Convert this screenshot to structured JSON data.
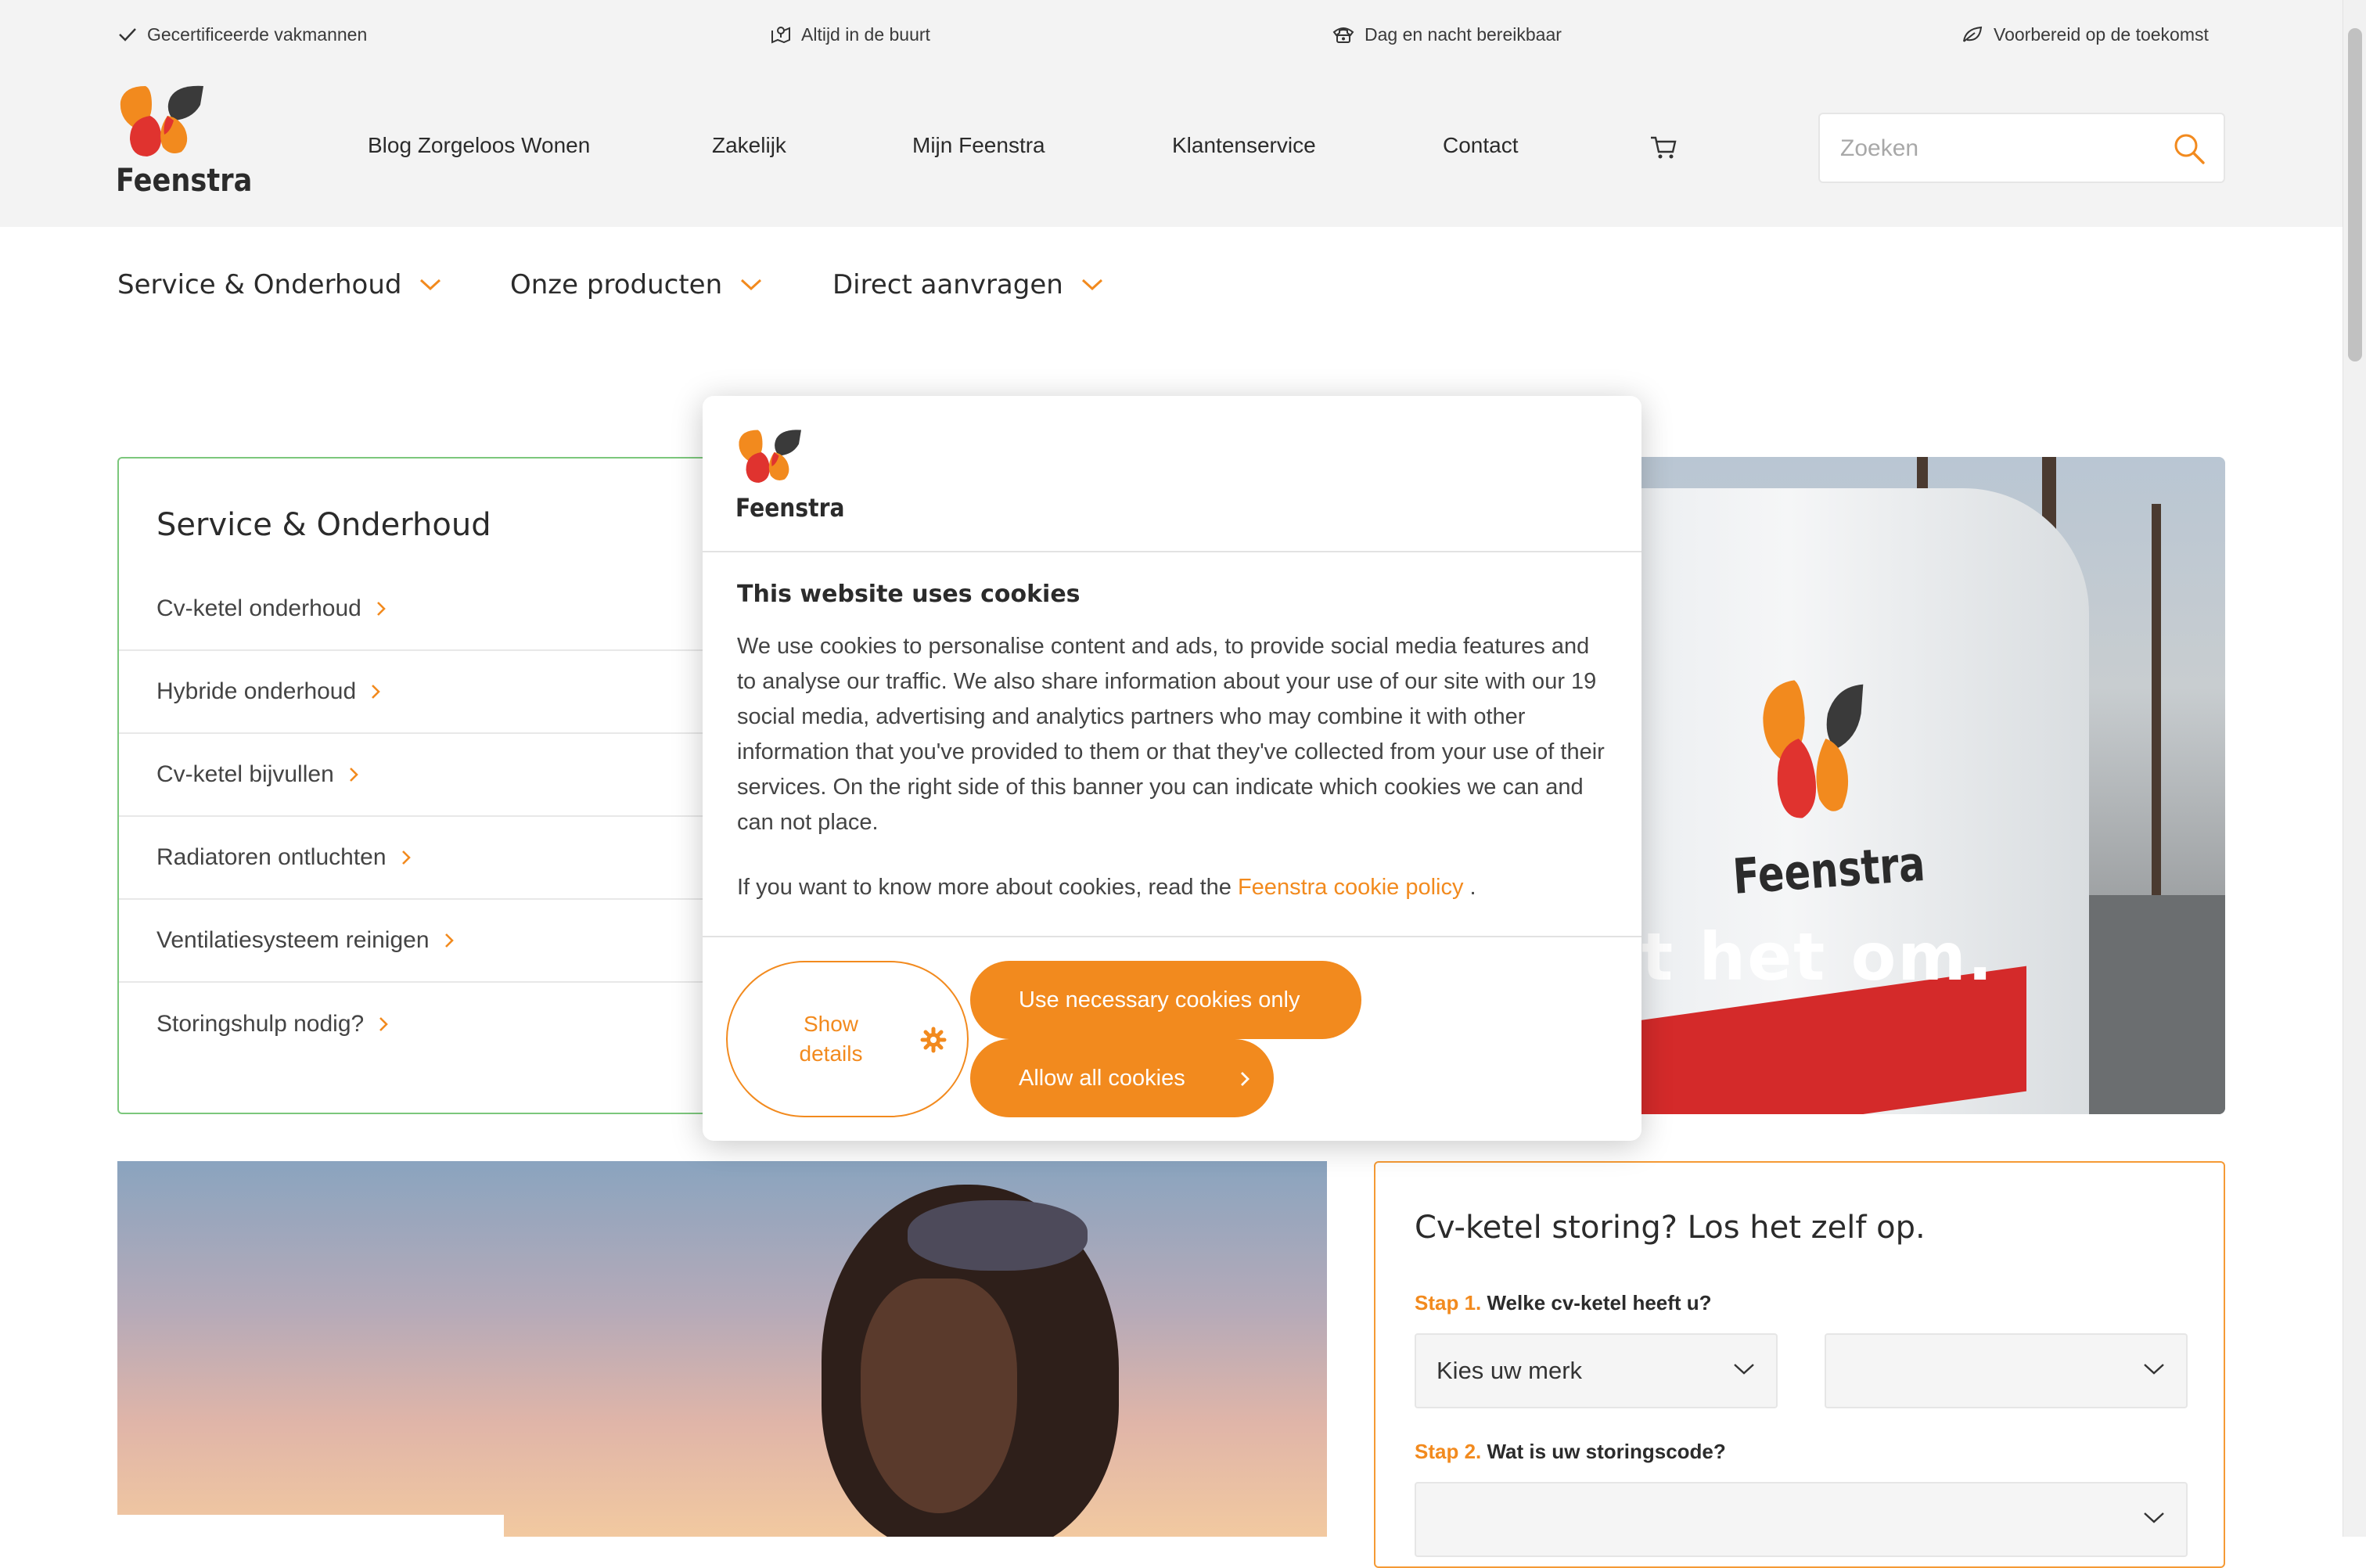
{
  "usp": [
    {
      "icon": "check-icon",
      "label": "Gecertificeerde vakmannen"
    },
    {
      "icon": "map-icon",
      "label": "Altijd in de buurt"
    },
    {
      "icon": "phone-icon",
      "label": "Dag en nacht bereikbaar"
    },
    {
      "icon": "leaf-icon",
      "label": "Voorbereid op de toekomst"
    }
  ],
  "brand": {
    "name": "Feenstra",
    "accent": "#f28a1e",
    "green": "#7cc77c"
  },
  "main_nav": [
    "Blog Zorgeloos Wonen",
    "Zakelijk",
    "Mijn Feenstra",
    "Klantenservice",
    "Contact"
  ],
  "search": {
    "placeholder": "Zoeken"
  },
  "sub_nav": [
    "Service & Onderhoud",
    "Onze producten",
    "Direct aanvragen"
  ],
  "service_panel": {
    "title": "Service & Onderhoud",
    "items": [
      "Cv-ketel onderhoud",
      "Hybride onderhoud",
      "Cv-ketel bijvullen",
      "Radiatoren ontluchten",
      "Ventilatiesysteem reinigen",
      "Storingshulp nodig?"
    ]
  },
  "hero": {
    "text_visible": "t het om.",
    "van_brand": "Feenstra"
  },
  "storing_panel": {
    "title": "Cv-ketel storing? Los het zelf op.",
    "step1": {
      "num": "Stap 1.",
      "label": "Welke cv-ketel heeft u?"
    },
    "brand_select": "Kies uw merk",
    "step2": {
      "num": "Stap 2.",
      "label": "Wat is uw storingscode?"
    }
  },
  "cookie": {
    "title": "This website uses cookies",
    "body": "We use cookies to personalise content and ads, to provide social media features and to analyse our traffic. We also share information about your use of our site with our 19 social media, advertising and analytics partners who may combine it with other information that you've provided to them or that they've collected from your use of their services. On the right side of this banner you can indicate which cookies we can and can not place.",
    "more_prefix": "If you want to know more about cookies, read the ",
    "more_link": "Feenstra cookie policy",
    "more_suffix": " .",
    "show_details": "Show details",
    "necessary_only": "Use necessary cookies only",
    "allow_all": "Allow all cookies"
  }
}
